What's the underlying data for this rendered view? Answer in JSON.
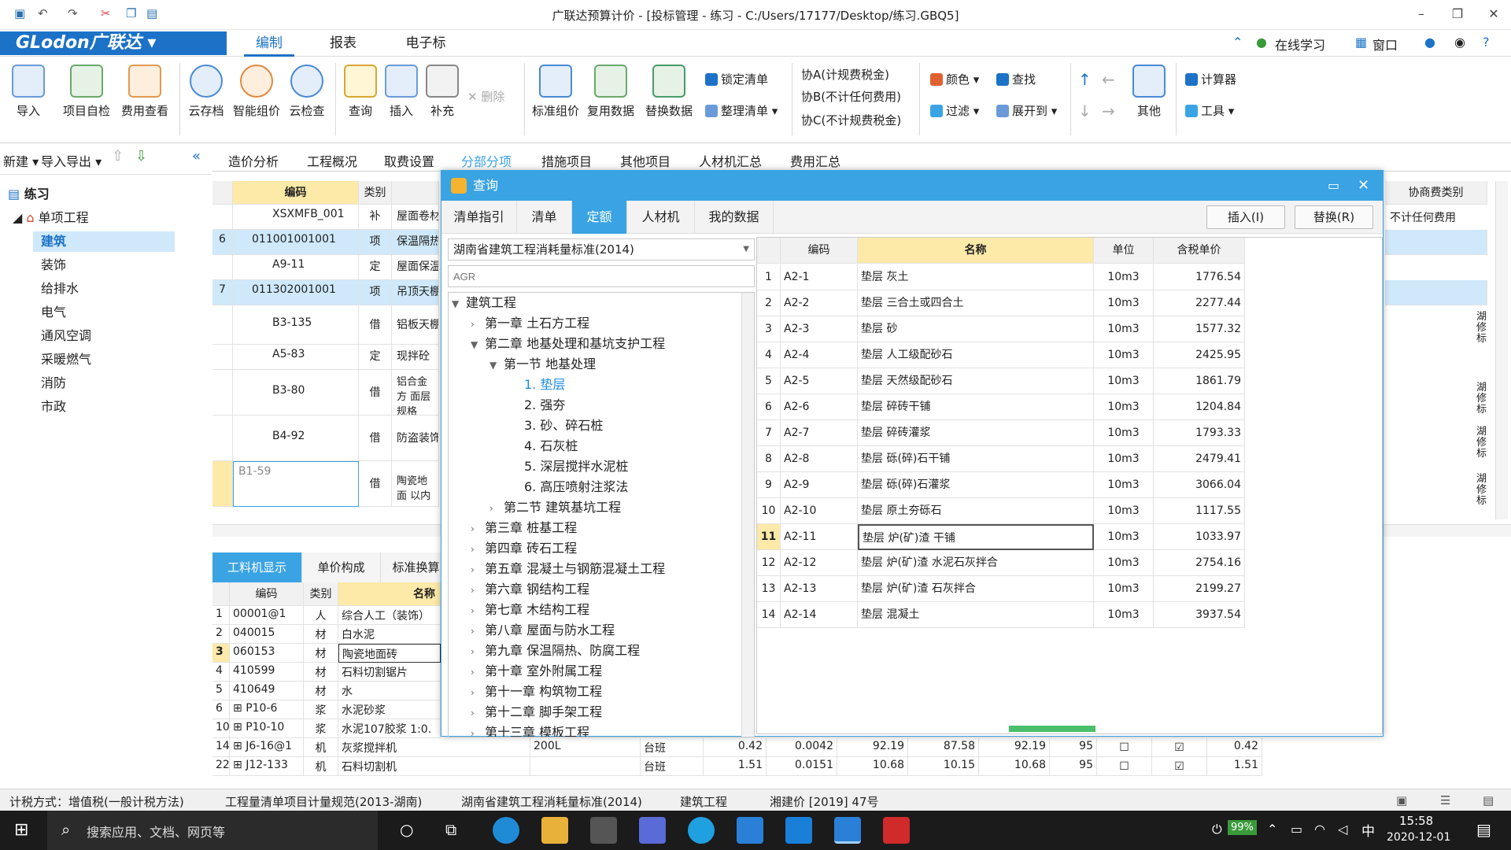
{
  "window": {
    "title": "广联达预算计价 - [投标管理 - 练习 - C:/Users/17177/Desktop/练习.GBQ5]"
  },
  "menubar": {
    "logo": "GLodon广联达",
    "tabs": [
      "编制",
      "报表",
      "电子标"
    ],
    "online_learning": "在线学习",
    "window_menu": "窗口"
  },
  "ribbon": {
    "big_buttons": [
      "导入",
      "项目自检",
      "费用查看",
      "云存档",
      "智能组价",
      "云检查",
      "查询",
      "插入",
      "补充",
      "标准组价",
      "复用数据",
      "替换数据",
      "其他"
    ],
    "delete_label": "删除",
    "lock_list": "锁定清单",
    "organize_list": "整理清单",
    "xie_a": "协A(计规费税金)",
    "xie_b": "协B(不计任何费用)",
    "xie_c": "协C(不计规费税金)",
    "color": "颜色",
    "find": "查找",
    "filter": "过滤",
    "expand": "展开到",
    "calculator": "计算器",
    "tools": "工具"
  },
  "left": {
    "new": "新建",
    "import_export": "导入导出",
    "root": "练习",
    "project": "单项工程",
    "items": [
      "建筑",
      "装饰",
      "给排水",
      "电气",
      "通风空调",
      "采暖燃气",
      "消防",
      "市政"
    ]
  },
  "content_tabs": [
    "造价分析",
    "工程概况",
    "取费设置",
    "分部分项",
    "措施项目",
    "其他项目",
    "人材机汇总",
    "费用汇总"
  ],
  "main_table": {
    "headers": {
      "code": "编码",
      "type": "类别",
      "right": "协商费类别"
    },
    "rows": [
      {
        "num": "",
        "code": "XSXMFB_001",
        "type": "补",
        "name": "屋面卷材"
      },
      {
        "num": "6",
        "code": "011001001001",
        "type": "项",
        "name": "保温隔热"
      },
      {
        "num": "",
        "code": "A9-11",
        "type": "定",
        "name": "屋面保温"
      },
      {
        "num": "7",
        "code": "011302001001",
        "type": "项",
        "name": "吊顶天棚"
      },
      {
        "num": "",
        "code": "B3-135",
        "type": "借",
        "name": "铝板天棚"
      },
      {
        "num": "",
        "code": "A5-83",
        "type": "定",
        "name": "现拌砼"
      },
      {
        "num": "",
        "code": "B3-80",
        "type": "借",
        "name": "铝合金方 面层规格"
      },
      {
        "num": "",
        "code": "B4-92",
        "type": "借",
        "name": "防盗装饰"
      },
      {
        "num": "",
        "code": "B1-59",
        "type": "借",
        "name": "陶瓷地面 以内"
      }
    ],
    "right_col_value": "不计任何费用",
    "right_col_notes": [
      "湖 修 标",
      "湖 修 标",
      "湖 修 标",
      "湖 修 标"
    ]
  },
  "bottom": {
    "tabs": [
      "工料机显示",
      "单价构成",
      "标准换算"
    ],
    "headers": [
      "编码",
      "类别",
      "名称"
    ],
    "rows": [
      {
        "num": "1",
        "code": "00001@1",
        "type": "人",
        "name": "综合人工（装饰）"
      },
      {
        "num": "2",
        "code": "040015",
        "type": "材",
        "name": "白水泥"
      },
      {
        "num": "3",
        "code": "060153",
        "type": "材",
        "name": "陶瓷地面砖"
      },
      {
        "num": "4",
        "code": "410599",
        "type": "材",
        "name": "石料切割锯片"
      },
      {
        "num": "5",
        "code": "410649",
        "type": "材",
        "name": "水"
      },
      {
        "num": "6",
        "code": "P10-6",
        "type": "浆",
        "name": "水泥砂浆"
      },
      {
        "num": "10",
        "code": "P10-10",
        "type": "浆",
        "name": "水泥107胶浆 1:0."
      },
      {
        "num": "14",
        "code": "J6-16@1",
        "type": "机",
        "name": "灰浆搅拌机",
        "spec": "200L",
        "unit": "台班",
        "v1": "0.42",
        "v2": "0.0042",
        "v3": "92.19",
        "v4": "87.58",
        "v5": "92.19",
        "v6": "95",
        "v7": "0.42"
      },
      {
        "num": "22",
        "code": "J12-133",
        "type": "机",
        "name": "石料切割机",
        "spec": "",
        "unit": "台班",
        "v1": "1.51",
        "v2": "0.0151",
        "v3": "10.68",
        "v4": "10.15",
        "v5": "10.68",
        "v6": "95",
        "v7": "1.51"
      }
    ]
  },
  "dialog": {
    "title": "查询",
    "tabs": [
      "清单指引",
      "清单",
      "定额",
      "人材机",
      "我的数据"
    ],
    "insert_btn": "插入(I)",
    "replace_btn": "替换(R)",
    "standard": "湖南省建筑工程消耗量标准(2014)",
    "search_placeholder": "AGR",
    "tree": [
      {
        "level": 0,
        "label": "建筑工程",
        "arrow": "▼"
      },
      {
        "level": 1,
        "label": "第一章  土石方工程",
        "arrow": "›"
      },
      {
        "level": 1,
        "label": "第二章  地基处理和基坑支护工程",
        "arrow": "▼"
      },
      {
        "level": 2,
        "label": "第一节  地基处理",
        "arrow": "▼"
      },
      {
        "level": 3,
        "label": "1.  垫层",
        "arrow": "",
        "selected": true
      },
      {
        "level": 3,
        "label": "2.  强夯",
        "arrow": ""
      },
      {
        "level": 3,
        "label": "3.  砂、碎石桩",
        "arrow": ""
      },
      {
        "level": 3,
        "label": "4.  石灰桩",
        "arrow": ""
      },
      {
        "level": 3,
        "label": "5.  深层搅拌水泥桩",
        "arrow": ""
      },
      {
        "level": 3,
        "label": "6.  高压喷射注浆法",
        "arrow": ""
      },
      {
        "level": 2,
        "label": "第二节  建筑基坑工程",
        "arrow": "›"
      },
      {
        "level": 1,
        "label": "第三章  桩基工程",
        "arrow": "›"
      },
      {
        "level": 1,
        "label": "第四章  砖石工程",
        "arrow": "›"
      },
      {
        "level": 1,
        "label": "第五章  混凝土与钢筋混凝土工程",
        "arrow": "›"
      },
      {
        "level": 1,
        "label": "第六章  钢结构工程",
        "arrow": "›"
      },
      {
        "level": 1,
        "label": "第七章  木结构工程",
        "arrow": "›"
      },
      {
        "level": 1,
        "label": "第八章  屋面与防水工程",
        "arrow": "›"
      },
      {
        "level": 1,
        "label": "第九章  保温隔热、防腐工程",
        "arrow": "›"
      },
      {
        "level": 1,
        "label": "第十章  室外附属工程",
        "arrow": "›"
      },
      {
        "level": 1,
        "label": "第十一章  构筑物工程",
        "arrow": "›"
      },
      {
        "level": 1,
        "label": "第十二章  脚手架工程",
        "arrow": "›"
      },
      {
        "level": 1,
        "label": "第十三章  模板工程",
        "arrow": "›"
      }
    ],
    "grid_headers": [
      "编码",
      "名称",
      "单位",
      "含税单价"
    ],
    "grid_rows": [
      {
        "n": "1",
        "code": "A2-1",
        "name": "垫层  灰土",
        "unit": "10m3",
        "price": "1776.54"
      },
      {
        "n": "2",
        "code": "A2-2",
        "name": "垫层  三合土或四合土",
        "unit": "10m3",
        "price": "2277.44"
      },
      {
        "n": "3",
        "code": "A2-3",
        "name": "垫层  砂",
        "unit": "10m3",
        "price": "1577.32"
      },
      {
        "n": "4",
        "code": "A2-4",
        "name": "垫层  人工级配砂石",
        "unit": "10m3",
        "price": "2425.95"
      },
      {
        "n": "5",
        "code": "A2-5",
        "name": "垫层  天然级配砂石",
        "unit": "10m3",
        "price": "1861.79"
      },
      {
        "n": "6",
        "code": "A2-6",
        "name": "垫层  碎砖干铺",
        "unit": "10m3",
        "price": "1204.84"
      },
      {
        "n": "7",
        "code": "A2-7",
        "name": "垫层  碎砖灌浆",
        "unit": "10m3",
        "price": "1793.33"
      },
      {
        "n": "8",
        "code": "A2-8",
        "name": "垫层  砾(碎)石干铺",
        "unit": "10m3",
        "price": "2479.41"
      },
      {
        "n": "9",
        "code": "A2-9",
        "name": "垫层  砾(碎)石灌浆",
        "unit": "10m3",
        "price": "3066.04"
      },
      {
        "n": "10",
        "code": "A2-10",
        "name": "垫层  原土夯砾石",
        "unit": "10m3",
        "price": "1117.55"
      },
      {
        "n": "11",
        "code": "A2-11",
        "name": "垫层  炉(矿)渣  干铺",
        "unit": "10m3",
        "price": "1033.97",
        "selected": true
      },
      {
        "n": "12",
        "code": "A2-12",
        "name": "垫层  炉(矿)渣  水泥石灰拌合",
        "unit": "10m3",
        "price": "2754.16"
      },
      {
        "n": "13",
        "code": "A2-13",
        "name": "垫层  炉(矿)渣  石灰拌合",
        "unit": "10m3",
        "price": "2199.27"
      },
      {
        "n": "14",
        "code": "A2-14",
        "name": "垫层  混凝土",
        "unit": "10m3",
        "price": "3937.54"
      }
    ]
  },
  "statusbar": {
    "items": [
      "计税方式：增值税(一般计税方法)",
      "工程量清单项目计量规范(2013-湖南)",
      "湖南省建筑工程消耗量标准(2014)",
      "建筑工程",
      "湘建价 [2019] 47号"
    ]
  },
  "taskbar": {
    "search": "搜索应用、文档、网页等",
    "battery": "99%",
    "ime": "中",
    "time": "15:58",
    "date": "2020-12-01"
  }
}
